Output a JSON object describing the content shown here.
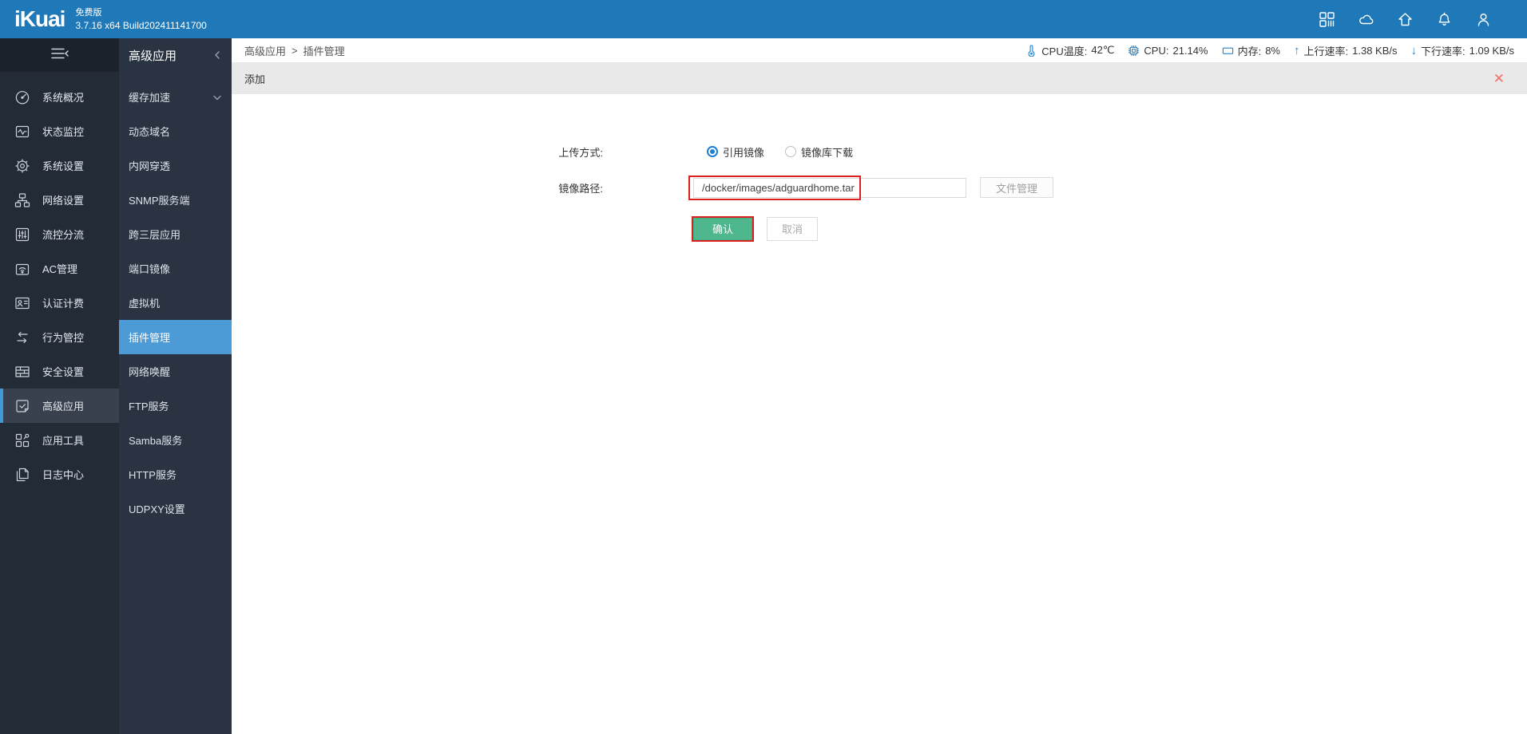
{
  "topbar": {
    "logo": "iKuai",
    "edition": "免费版",
    "build": "3.7.16 x64 Build202411141700",
    "icons": [
      "apps-grid-icon",
      "cloud-icon",
      "home-icon",
      "bell-icon",
      "user-icon"
    ]
  },
  "sidebar": {
    "items": [
      {
        "label": "系统概况",
        "icon": "gauge-icon"
      },
      {
        "label": "状态监控",
        "icon": "monitor-pulse-icon"
      },
      {
        "label": "系统设置",
        "icon": "gear-icon"
      },
      {
        "label": "网络设置",
        "icon": "sitemap-icon"
      },
      {
        "label": "流控分流",
        "icon": "sliders-icon"
      },
      {
        "label": "AC管理",
        "icon": "wifi-device-icon"
      },
      {
        "label": "认证计费",
        "icon": "id-card-icon"
      },
      {
        "label": "行为管控",
        "icon": "swap-arrows-icon"
      },
      {
        "label": "安全设置",
        "icon": "firewall-icon"
      },
      {
        "label": "高级应用",
        "icon": "doc-check-icon",
        "active": true
      },
      {
        "label": "应用工具",
        "icon": "tools-grid-icon"
      },
      {
        "label": "日志中心",
        "icon": "pages-icon"
      }
    ]
  },
  "submenu": {
    "title": "高级应用",
    "items": [
      {
        "label": "缓存加速",
        "expandable": true
      },
      {
        "label": "动态域名"
      },
      {
        "label": "内网穿透"
      },
      {
        "label": "SNMP服务端"
      },
      {
        "label": "跨三层应用"
      },
      {
        "label": "端口镜像"
      },
      {
        "label": "虚拟机"
      },
      {
        "label": "插件管理",
        "active": true
      },
      {
        "label": "网络唤醒"
      },
      {
        "label": "FTP服务"
      },
      {
        "label": "Samba服务"
      },
      {
        "label": "HTTP服务"
      },
      {
        "label": "UDPXY设置"
      }
    ]
  },
  "breadcrumb": {
    "parent": "高级应用",
    "separator": ">",
    "current": "插件管理"
  },
  "status": {
    "cpu_temp_label": "CPU温度:",
    "cpu_temp_value": "42℃",
    "cpu_label": "CPU:",
    "cpu_value": "21.14%",
    "mem_label": "内存:",
    "mem_value": "8%",
    "up_label": "上行速率:",
    "up_value": "1.38 KB/s",
    "down_label": "下行速率:",
    "down_value": "1.09 KB/s",
    "up_arrow": "↑",
    "down_arrow": "↓"
  },
  "panel": {
    "title": "添加",
    "close_glyph": "✕",
    "form": {
      "upload_label": "上传方式:",
      "radio_selected_label": "引用镜像",
      "radio_unselected_label": "镜像库下载",
      "path_label": "镜像路径:",
      "path_value": "/docker/images/adguardhome.tar",
      "file_manager_label": "文件管理",
      "confirm_label": "确认",
      "cancel_label": "取消"
    }
  },
  "colors": {
    "topbar_blue": "#1f78b7",
    "sidebar_dark": "#222b36",
    "submenu_dark": "#2a3342",
    "active_item_blue": "#4d9bd6",
    "status_icon_blue": "#2a85c8",
    "confirm_green": "#4eb78e",
    "annotation_red": "#dc1f1f",
    "close_red": "#f56c6c"
  }
}
